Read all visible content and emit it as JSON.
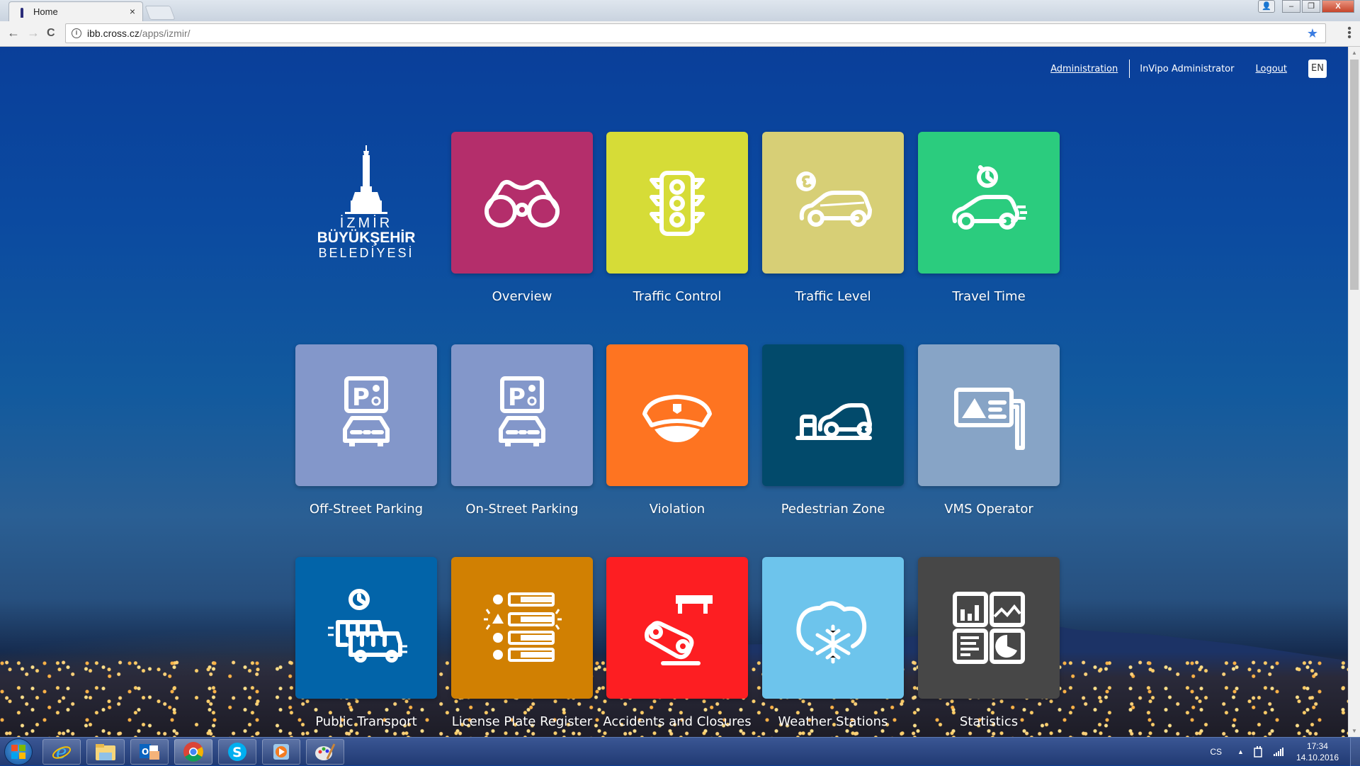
{
  "browser": {
    "tab_title": "Home",
    "tab_close": "×",
    "url_host": "ibb.cross.cz",
    "url_path": "/apps/izmir/",
    "back": "←",
    "forward": "→",
    "reload": "C",
    "star": "★",
    "menu": "⋮",
    "window_controls": {
      "minimize": "–",
      "restore": "❐",
      "close": "X",
      "user": "👤"
    }
  },
  "header": {
    "administration": "Administration",
    "username": "InVipo Administrator",
    "logout": "Logout",
    "language": "EN"
  },
  "logo": {
    "line1": "İZMİR",
    "line2": "BÜYÜKŞEHİR",
    "line3": "BELEDİYESİ"
  },
  "apps": [
    {
      "label": "Overview",
      "icon": "binoculars-icon",
      "color": "#b42e6b"
    },
    {
      "label": "Traffic Control",
      "icon": "traffic-light-icon",
      "color": "#d6dc37"
    },
    {
      "label": "Traffic Level",
      "icon": "car-speed-icon",
      "color": "#d7cf76"
    },
    {
      "label": "Travel Time",
      "icon": "car-stopwatch-icon",
      "color": "#2bcc7e"
    },
    {
      "label": "Off-Street Parking",
      "icon": "parking-car-icon",
      "color": "#8397ca"
    },
    {
      "label": "On-Street Parking",
      "icon": "parking-car-icon",
      "color": "#8397ca"
    },
    {
      "label": "Violation",
      "icon": "police-cap-icon",
      "color": "#fe7421"
    },
    {
      "label": "Pedestrian Zone",
      "icon": "bollard-car-icon",
      "color": "#024a6b"
    },
    {
      "label": "VMS Operator",
      "icon": "vms-sign-icon",
      "color": "#87a4c6"
    },
    {
      "label": "Public Transport",
      "icon": "bus-clock-icon",
      "color": "#0264a9"
    },
    {
      "label": "License Plate Register",
      "icon": "plate-list-icon",
      "color": "#d18002"
    },
    {
      "label": "Accidents and Closures",
      "icon": "accident-barrier-icon",
      "color": "#fd1e22"
    },
    {
      "label": "Weather Stations",
      "icon": "snow-cloud-icon",
      "color": "#6dc4ec"
    },
    {
      "label": "Statistics",
      "icon": "charts-grid-icon",
      "color": "#474747"
    }
  ],
  "taskbar": {
    "apps": [
      "Internet Explorer",
      "File Explorer",
      "Outlook",
      "Chrome",
      "Skype",
      "Media Player",
      "Paint"
    ],
    "language": "CS",
    "time": "17:34",
    "date": "14.10.2016",
    "tray_expand": "▲"
  }
}
